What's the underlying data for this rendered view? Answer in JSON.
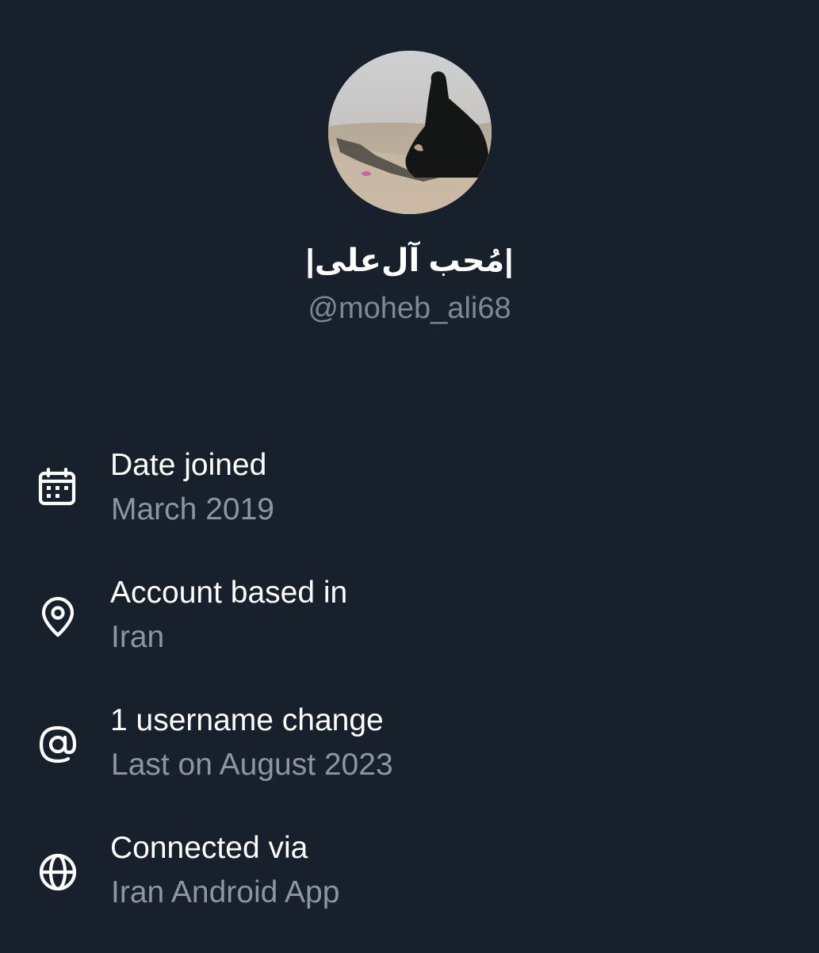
{
  "profile": {
    "display_name": "|مُحب آل‌علی|",
    "handle": "@moheb_ali68",
    "avatar_icon": "profile-photo"
  },
  "info": [
    {
      "icon": "calendar-icon",
      "title": "Date joined",
      "value": "March 2019"
    },
    {
      "icon": "location-pin-icon",
      "title": "Account based in",
      "value": "Iran"
    },
    {
      "icon": "at-sign-icon",
      "title": "1 username change",
      "value": "Last on August 2023"
    },
    {
      "icon": "globe-icon",
      "title": "Connected via",
      "value": "Iran Android App"
    }
  ],
  "colors": {
    "background": "#18202b",
    "primary_text": "#ffffff",
    "secondary_text": "#8b96a3"
  }
}
